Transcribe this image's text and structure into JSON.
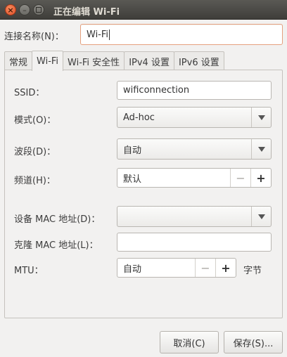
{
  "window": {
    "title": "正在编辑 Wi-Fi",
    "close_glyph": "×",
    "min_glyph": "–"
  },
  "connection": {
    "label": "连接名称(N)：",
    "value": "Wi-Fi"
  },
  "tabs": [
    {
      "label": "常规"
    },
    {
      "label": "Wi-Fi",
      "active": true
    },
    {
      "label": "Wi-Fi 安全性"
    },
    {
      "label": "IPv4 设置"
    },
    {
      "label": "IPv6 设置"
    }
  ],
  "form": {
    "ssid": {
      "label": "SSID：",
      "value": "wificonnection"
    },
    "mode": {
      "label": "模式(O)：",
      "value": "Ad-hoc"
    },
    "band": {
      "label": "波段(D)：",
      "value": "自动"
    },
    "channel": {
      "label": "频道(H)：",
      "value": "默认",
      "minus": "−",
      "plus": "+"
    },
    "device_mac": {
      "label": "设备 MAC 地址(D)：",
      "value": ""
    },
    "cloned_mac": {
      "label": "克隆 MAC 地址(L)：",
      "value": ""
    },
    "mtu": {
      "label": "MTU：",
      "value": "自动",
      "minus": "−",
      "plus": "+",
      "unit": "字节"
    }
  },
  "buttons": {
    "cancel": "取消(C)",
    "save": "保存(S)..."
  },
  "colors": {
    "titlebar": "#3f3e3a",
    "close_button": "#e2502a",
    "focus_border": "#e5a07e",
    "window_bg": "#f2f1f0"
  }
}
